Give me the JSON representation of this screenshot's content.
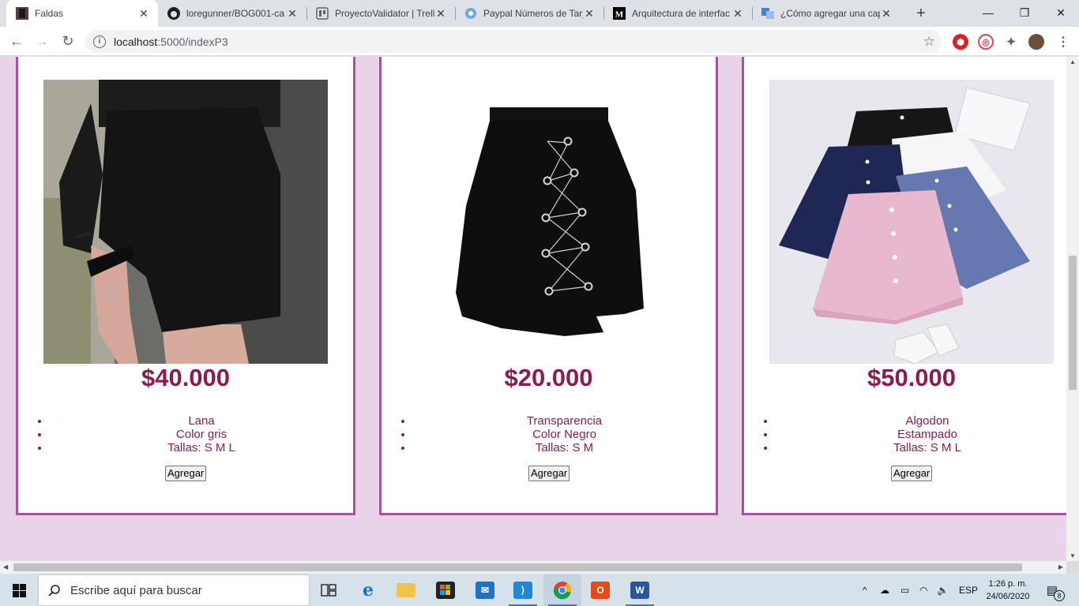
{
  "browser": {
    "tabs": [
      {
        "title": "Faldas",
        "icon": "skirt-favicon",
        "active": true
      },
      {
        "title": "loregunner/BOG001-ca",
        "icon": "github-icon",
        "active": false
      },
      {
        "title": "ProyectoValidator | Trell",
        "icon": "trello-icon",
        "active": false
      },
      {
        "title": "Paypal Números de Tarj",
        "icon": "paypal-icon",
        "active": false
      },
      {
        "title": "Arquitectura de interfac",
        "icon": "medium-icon",
        "active": false
      },
      {
        "title": "¿Cómo agregar una cap",
        "icon": "translate-icon",
        "active": false
      }
    ],
    "url_host": "localhost",
    "url_path": ":5000/indexP3"
  },
  "products": [
    {
      "price": "$40.000",
      "features": [
        "Lana",
        "Color gris",
        "Tallas: S M L"
      ],
      "button_label": "Agregar",
      "image": "black-asymmetric-skirt-photo"
    },
    {
      "price": "$20.000",
      "features": [
        "Transparencia",
        "Color Negro",
        "Tallas: S M"
      ],
      "button_label": "Agregar",
      "image": "black-lace-up-skirt-photo"
    },
    {
      "price": "$50.000",
      "features": [
        "Algodon",
        "Estampado",
        "Tallas: S M L"
      ],
      "button_label": "Agregar",
      "image": "pleated-skirts-photo"
    }
  ],
  "taskbar": {
    "search_placeholder": "Escribe aquí para buscar",
    "language": "ESP",
    "time": "1:26 p. m.",
    "date": "24/06/2020",
    "notification_count": "8"
  },
  "colors": {
    "page_background": "#e8d3e8",
    "card_border": "#a0559c",
    "price_text": "#8c1c4f"
  }
}
